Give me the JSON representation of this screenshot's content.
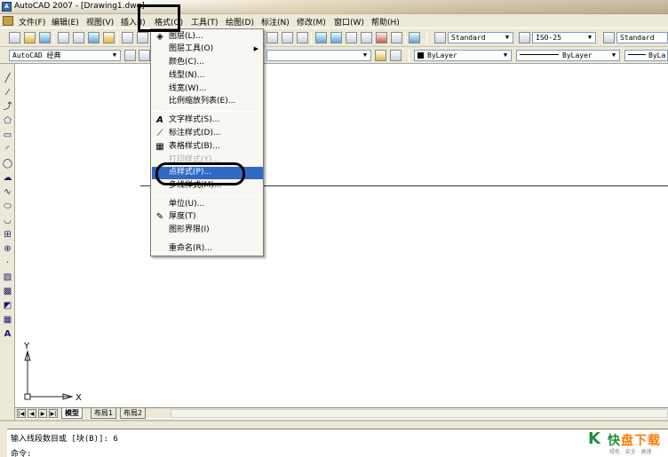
{
  "window": {
    "title": "AutoCAD 2007 - [Drawing1.dwg]",
    "app_icon": "autocad-icon"
  },
  "menubar": {
    "items": [
      {
        "label": "文件(F)"
      },
      {
        "label": "编辑(E)"
      },
      {
        "label": "视图(V)"
      },
      {
        "label": "插入(I)"
      },
      {
        "label": "格式(O)"
      },
      {
        "label": "工具(T)"
      },
      {
        "label": "绘图(D)"
      },
      {
        "label": "标注(N)"
      },
      {
        "label": "修改(M)"
      },
      {
        "label": "窗口(W)"
      },
      {
        "label": "帮助(H)"
      }
    ]
  },
  "toolbars": {
    "workspace": "AutoCAD 经典",
    "text_style": "Standard",
    "dim_style": "ISO-25",
    "table_style": "Standard",
    "color": "ByLayer",
    "linetype": "ByLayer",
    "lineweight": "ByLa"
  },
  "format_menu": {
    "items": [
      {
        "label": "图层(L)...",
        "icon": "layer-icon",
        "submenu": false,
        "disabled": false,
        "highlighted": false
      },
      {
        "label": "图层工具(O)",
        "icon": "",
        "submenu": true,
        "disabled": false,
        "highlighted": false
      },
      {
        "label": "颜色(C)...",
        "icon": "",
        "submenu": false,
        "disabled": false,
        "highlighted": false
      },
      {
        "label": "线型(N)...",
        "icon": "",
        "submenu": false,
        "disabled": false,
        "highlighted": false
      },
      {
        "label": "线宽(W)...",
        "icon": "",
        "submenu": false,
        "disabled": false,
        "highlighted": false
      },
      {
        "label": "比例缩放列表(E)...",
        "icon": "",
        "submenu": false,
        "disabled": false,
        "highlighted": false
      },
      {
        "label": "文字样式(S)...",
        "icon": "text-style-icon",
        "submenu": false,
        "disabled": false,
        "highlighted": false
      },
      {
        "label": "标注样式(D)...",
        "icon": "dim-style-icon",
        "submenu": false,
        "disabled": false,
        "highlighted": false
      },
      {
        "label": "表格样式(B)...",
        "icon": "table-style-icon",
        "submenu": false,
        "disabled": false,
        "highlighted": false
      },
      {
        "label": "打印样式(Y)...",
        "icon": "",
        "submenu": false,
        "disabled": true,
        "highlighted": false
      },
      {
        "label": "点样式(P)...",
        "icon": "",
        "submenu": false,
        "disabled": false,
        "highlighted": true
      },
      {
        "label": "多线样式(M)...",
        "icon": "",
        "submenu": false,
        "disabled": false,
        "highlighted": false
      },
      {
        "label": "单位(U)...",
        "icon": "",
        "submenu": false,
        "disabled": false,
        "highlighted": false
      },
      {
        "label": "厚度(T)",
        "icon": "thickness-icon",
        "submenu": false,
        "disabled": false,
        "highlighted": false
      },
      {
        "label": "图形界限(I)",
        "icon": "",
        "submenu": false,
        "disabled": false,
        "highlighted": false
      },
      {
        "label": "重命名(R)...",
        "icon": "",
        "submenu": false,
        "disabled": false,
        "highlighted": false
      }
    ]
  },
  "layout_tabs": [
    {
      "label": "模型"
    },
    {
      "label": "布局1"
    },
    {
      "label": "布局2"
    }
  ],
  "command": {
    "history": "输入线段数目或 [块(B)]: 6",
    "prompt": "命令:"
  },
  "ucs": {
    "x_label": "X",
    "y_label": "Y"
  },
  "watermark": {
    "mark": "K",
    "brand_main": "快",
    "brand_accent": "盘下载",
    "tagline": "绿色 · 安全 · 高速"
  },
  "colors": {
    "highlight": "#316ac5",
    "menu_bg": "#f8f7f2",
    "chrome": "#ece9d8",
    "brand_green": "#1f8f3a",
    "brand_orange": "#ff7a00"
  }
}
